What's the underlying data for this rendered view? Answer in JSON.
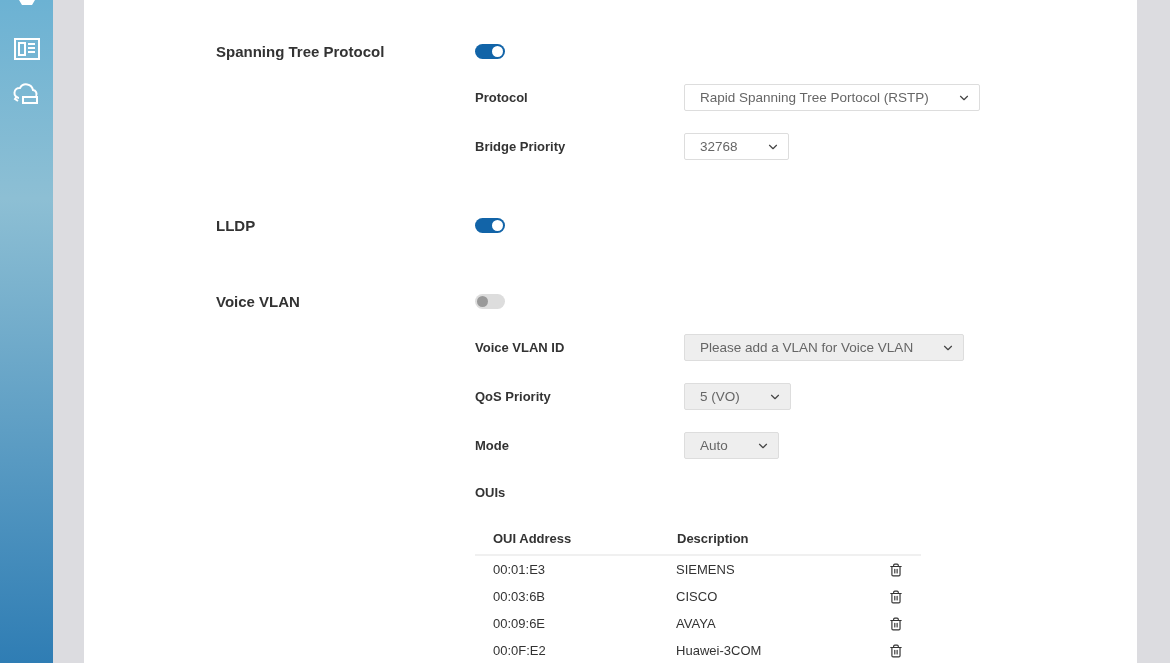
{
  "sections": [
    {
      "title": "Spanning Tree Protocol",
      "on": true,
      "fields": [
        {
          "kind": "select",
          "label": "Protocol",
          "value": "Rapid Spanning Tree Portocol (RSTP)",
          "disabled": false
        },
        {
          "kind": "select",
          "label": "Bridge Priority",
          "value": "32768",
          "disabled": false
        }
      ]
    },
    {
      "title": "LLDP",
      "on": true
    },
    {
      "title": "Voice VLAN",
      "on": false,
      "fields": [
        {
          "kind": "select",
          "label": "Voice VLAN ID",
          "value": "Please add a VLAN for Voice VLAN",
          "disabled": true
        },
        {
          "kind": "select",
          "label": "QoS Priority",
          "value": "5 (VO)",
          "disabled": true
        },
        {
          "kind": "select",
          "label": "Mode",
          "value": "Auto",
          "disabled": true
        },
        {
          "kind": "table",
          "label": "OUIs",
          "columns": [
            "OUI Address",
            "Description"
          ],
          "rows": [
            [
              "00:01:E3",
              "SIEMENS"
            ],
            [
              "00:03:6B",
              "CISCO"
            ],
            [
              "00:09:6E",
              "AVAYA"
            ],
            [
              "00:0F:E2",
              "Huawei-3COM"
            ]
          ]
        }
      ]
    }
  ]
}
